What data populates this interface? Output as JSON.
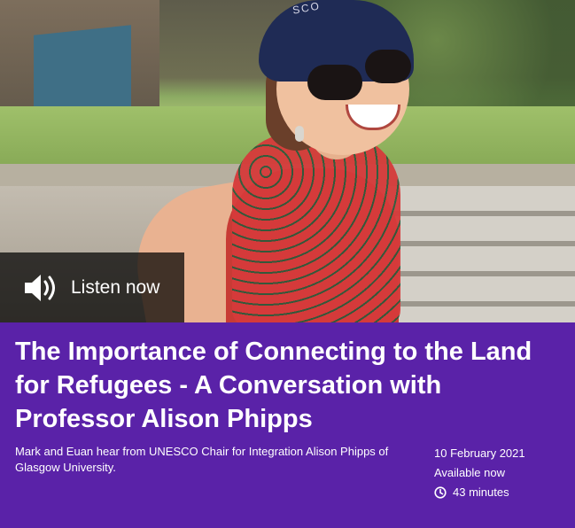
{
  "listen": {
    "label": "Listen now"
  },
  "episode": {
    "title": "The Importance of Connecting to the Land for Refugees - A Conversation with Professor Alison Phipps",
    "description": "Mark and Euan hear from UNESCO Chair for Integration Alison Phipps of Glasgow University.",
    "date": "10 February 2021",
    "availability": "Available now",
    "duration": "43 minutes"
  },
  "hero": {
    "cap_text": "SCO"
  },
  "icons": {
    "speaker": "speaker-icon",
    "clock": "clock-icon"
  },
  "colors": {
    "panel": "#5a22a8",
    "overlay": "#000000",
    "text": "#ffffff"
  }
}
